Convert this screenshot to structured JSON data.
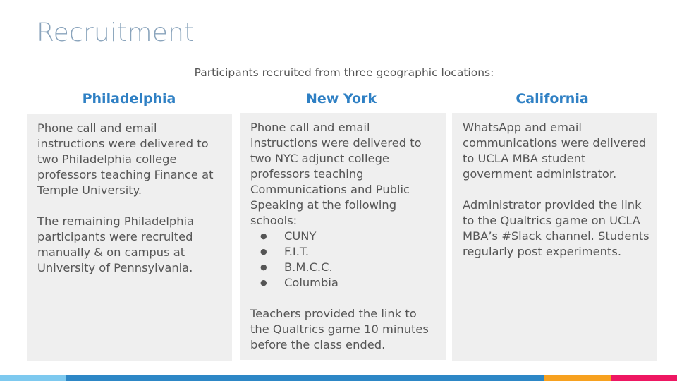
{
  "slide": {
    "title": "Recruitment",
    "subtitle": "Participants recruited from three geographic locations:"
  },
  "columns": [
    {
      "heading": "Philadelphia",
      "paragraphs": [
        "Phone call and email instructions were delivered to two Philadelphia college professors teaching Finance at Temple University.",
        "The remaining Philadelphia participants were recruited manually & on campus at University of Pennsylvania."
      ]
    },
    {
      "heading": "New York",
      "intro": "Phone call and email instructions were delivered to two NYC adjunct college professors teaching Communications and Public Speaking  at the following schools:",
      "schools": [
        "CUNY",
        "F.I.T.",
        "B.M.C.C.",
        "Columbia"
      ],
      "closing": "Teachers provided the link to the Qualtrics game 10 minutes before the class ended."
    },
    {
      "heading": "California",
      "paragraphs": [
        "WhatsApp and email communications were delivered to UCLA MBA student government administrator.",
        "Administrator  provided the link to the Qualtrics game on UCLA MBA’s #Slack channel. Students regularly post experiments."
      ]
    }
  ],
  "colors": {
    "title": "#8aa4bc",
    "heading": "#2f80c4",
    "body_text": "#555555",
    "card_background": "#efefef",
    "bar_segments": [
      "#7dc9ef",
      "#2d87c6",
      "#f7a11f",
      "#ee1762"
    ]
  }
}
